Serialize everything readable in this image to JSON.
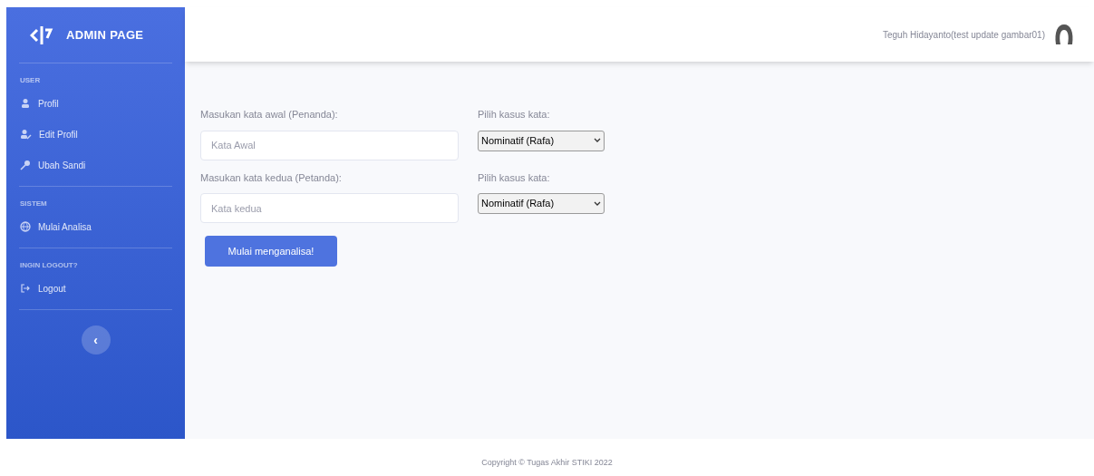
{
  "sidebar": {
    "brand": "ADMIN PAGE",
    "sections": [
      {
        "heading": "USER",
        "items": [
          {
            "label": "Profil",
            "kind": "user"
          },
          {
            "label": "Edit Profil",
            "kind": "edit"
          },
          {
            "label": "Ubah Sandi",
            "kind": "key"
          }
        ]
      },
      {
        "heading": "SISTEM",
        "items": [
          {
            "label": "Mulai Analisa",
            "kind": "globe"
          }
        ]
      },
      {
        "heading": "INGIN LOGOUT?",
        "items": [
          {
            "label": "Logout",
            "kind": "logout"
          }
        ]
      }
    ],
    "toggle": "‹"
  },
  "topbar": {
    "user": "Teguh Hidayanto(test update gambar01)"
  },
  "form": {
    "rows": [
      {
        "label": "Masukan kata awal (Penanda):",
        "placeholder": "Kata Awal",
        "case_label": "Pilih kasus kata:",
        "case_value": "Nominatif (Rafa)"
      },
      {
        "label": "Masukan kata kedua (Petanda):",
        "placeholder": "Kata kedua",
        "case_label": "Pilih kasus kata:",
        "case_value": "Nominatif (Rafa)"
      }
    ],
    "submit": "Mulai menganalisa!"
  },
  "footer": "Copyright © Tugas Akhir STIKI 2022"
}
